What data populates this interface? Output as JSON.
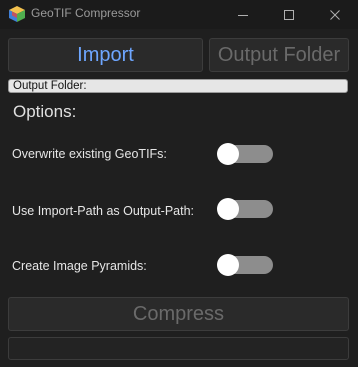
{
  "window": {
    "title": "GeoTIF Compressor",
    "app_icon": "geotif-app-icon",
    "controls": [
      "minimize-icon",
      "maximize-icon",
      "close-icon"
    ]
  },
  "toolbar": {
    "import_label": "Import",
    "output_folder_label": "Output Folder"
  },
  "output_folder": {
    "label": "Output Folder:"
  },
  "options": {
    "heading": "Options:",
    "items": [
      {
        "label": "Overwrite existing GeoTIFs:",
        "enabled": false
      },
      {
        "label": "Use Import-Path as Output-Path:",
        "enabled": false
      },
      {
        "label": "Create Image Pyramids:",
        "enabled": false
      }
    ]
  },
  "actions": {
    "compress_label": "Compress"
  },
  "status": {
    "text": ""
  },
  "colors": {
    "background": "#1f1f1f",
    "accent": "#6ea6ff",
    "disabled_text": "#6a6a6a",
    "toggle_track": "#8d8d8d",
    "toggle_knob": "#ffffff"
  }
}
